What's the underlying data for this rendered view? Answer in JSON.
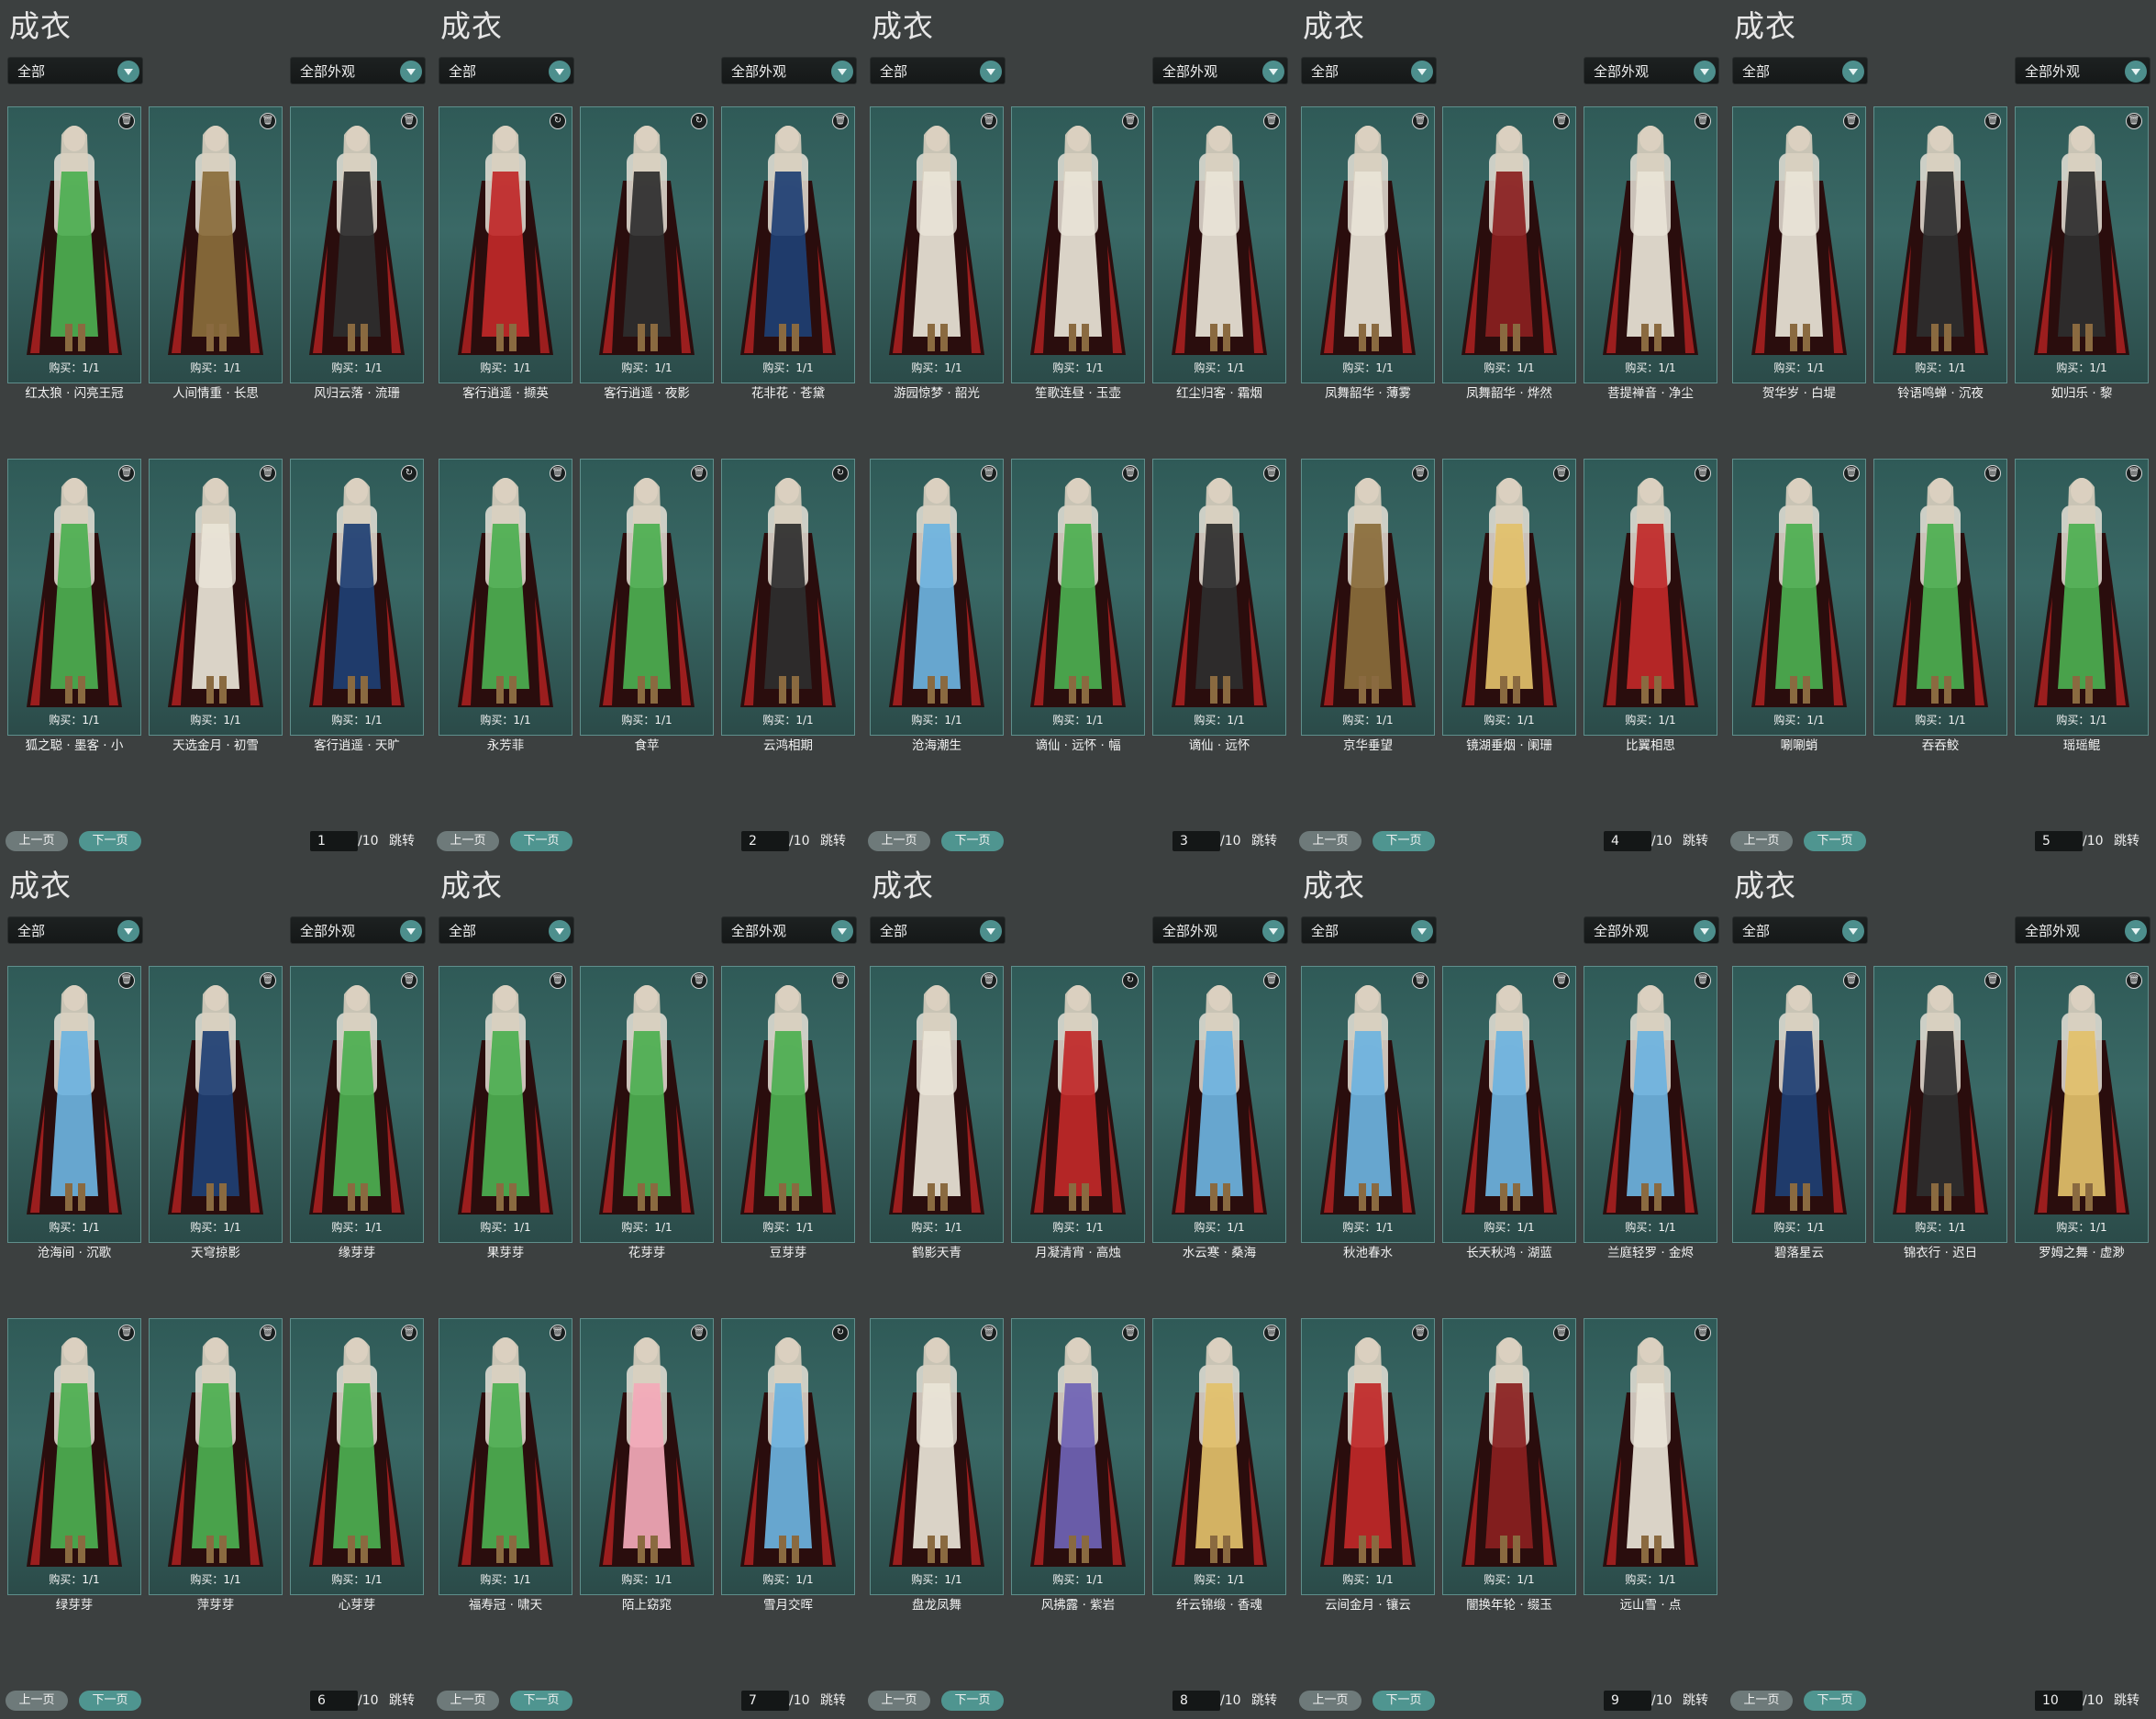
{
  "panel_title": "成衣",
  "filter_all": "全部",
  "filter_look": "全部外观",
  "buy_label": "购买：1/1",
  "prev_label": "上一页",
  "next_label": "下一页",
  "jump_label": "跳转",
  "total_label": "/10",
  "colors": {
    "card_bg": "#2f5a57",
    "accent": "#4f9590",
    "page_bg": "#3c4040",
    "dress_palette": [
      "#c02828",
      "#e9e4d7",
      "#2e2e2e",
      "#4caf50",
      "#6db3e0",
      "#1e3f73",
      "#8a6d3b",
      "#e2c06a",
      "#8a2020",
      "#f3a9b9",
      "#6f63b5"
    ]
  },
  "panels": [
    {
      "page": "1",
      "items": [
        {
          "name": "红太狼 · 闪亮王冠",
          "icon": "trash-icon"
        },
        {
          "name": "人间情重 · 长思",
          "icon": "trash-icon"
        },
        {
          "name": "风归云落 · 流珊",
          "icon": "trash-icon"
        },
        {
          "name": "狐之聪 · 墨客 · 小",
          "icon": "trash-icon"
        },
        {
          "name": "天选金月 · 初雪",
          "icon": "trash-icon"
        },
        {
          "name": "客行逍遥 · 天旷",
          "icon": "cycle-icon"
        }
      ]
    },
    {
      "page": "2",
      "items": [
        {
          "name": "客行逍遥 · 撷英",
          "icon": "cycle-icon"
        },
        {
          "name": "客行逍遥 · 夜影",
          "icon": "cycle-icon"
        },
        {
          "name": "花非花 · 苍黛",
          "icon": "trash-icon"
        },
        {
          "name": "永芳菲",
          "icon": "trash-icon"
        },
        {
          "name": "食苹",
          "icon": "trash-icon"
        },
        {
          "name": "云鸿相期",
          "icon": "cycle-icon"
        }
      ]
    },
    {
      "page": "3",
      "items": [
        {
          "name": "游园惊梦 · 韶光",
          "icon": "trash-icon"
        },
        {
          "name": "笙歌连昼 · 玉壶",
          "icon": "trash-icon"
        },
        {
          "name": "红尘归客 · 霜烟",
          "icon": "trash-icon"
        },
        {
          "name": "沧海潮生",
          "icon": "trash-icon"
        },
        {
          "name": "谪仙 · 远怀 · 幅",
          "icon": "trash-icon"
        },
        {
          "name": "谪仙 · 远怀",
          "icon": "trash-icon"
        }
      ]
    },
    {
      "page": "4",
      "items": [
        {
          "name": "凤舞韶华 · 薄雾",
          "icon": "trash-icon"
        },
        {
          "name": "凤舞韶华 · 烨然",
          "icon": "trash-icon"
        },
        {
          "name": "菩提禅音 · 净尘",
          "icon": "trash-icon"
        },
        {
          "name": "京华垂望",
          "icon": "trash-icon"
        },
        {
          "name": "镜湖垂烟 · 阑珊",
          "icon": "trash-icon"
        },
        {
          "name": "比翼相思",
          "icon": "trash-icon"
        }
      ]
    },
    {
      "page": "5",
      "items": [
        {
          "name": "贺华岁 · 白堤",
          "icon": "trash-icon"
        },
        {
          "name": "铃语鸣蝉 · 沉夜",
          "icon": "trash-icon"
        },
        {
          "name": "如归乐 · 黎",
          "icon": "trash-icon"
        },
        {
          "name": "唰唰蛸",
          "icon": "trash-icon"
        },
        {
          "name": "吞吞鲛",
          "icon": "trash-icon"
        },
        {
          "name": "瑶瑶鲲",
          "icon": "trash-icon"
        }
      ]
    },
    {
      "page": "6",
      "items": [
        {
          "name": "沧海间 · 沉歌",
          "icon": "trash-icon"
        },
        {
          "name": "天穹掠影",
          "icon": "trash-icon"
        },
        {
          "name": "缘芽芽",
          "icon": "trash-icon"
        },
        {
          "name": "绿芽芽",
          "icon": "trash-icon"
        },
        {
          "name": "萍芽芽",
          "icon": "trash-icon"
        },
        {
          "name": "心芽芽",
          "icon": "trash-icon"
        }
      ]
    },
    {
      "page": "7",
      "items": [
        {
          "name": "果芽芽",
          "icon": "trash-icon"
        },
        {
          "name": "花芽芽",
          "icon": "trash-icon"
        },
        {
          "name": "豆芽芽",
          "icon": "trash-icon"
        },
        {
          "name": "福寿冠 · 啸天",
          "icon": "trash-icon"
        },
        {
          "name": "陌上窈窕",
          "icon": "trash-icon"
        },
        {
          "name": "雪月交晖",
          "icon": "cycle-icon"
        }
      ]
    },
    {
      "page": "8",
      "items": [
        {
          "name": "鹤影天青",
          "icon": "trash-icon"
        },
        {
          "name": "月凝清宵 · 高烛",
          "icon": "cycle-icon"
        },
        {
          "name": "水云寒 · 桑海",
          "icon": "trash-icon"
        },
        {
          "name": "盘龙凤舞",
          "icon": "trash-icon"
        },
        {
          "name": "风拂露 · 紫岩",
          "icon": "trash-icon"
        },
        {
          "name": "纤云锦缎 · 香魂",
          "icon": "trash-icon"
        }
      ]
    },
    {
      "page": "9",
      "items": [
        {
          "name": "秋池春水",
          "icon": "trash-icon"
        },
        {
          "name": "长天秋鸿 · 湖蓝",
          "icon": "trash-icon"
        },
        {
          "name": "兰庭轻罗 · 金烬",
          "icon": "trash-icon"
        },
        {
          "name": "云间金月 · 镶云",
          "icon": "trash-icon"
        },
        {
          "name": "闇换年轮 · 缀玉",
          "icon": "trash-icon"
        },
        {
          "name": "远山雪 · 点",
          "icon": "trash-icon"
        }
      ]
    },
    {
      "page": "10",
      "items": [
        {
          "name": "碧落星云",
          "icon": "trash-icon"
        },
        {
          "name": "锦衣行 · 迟日",
          "icon": "trash-icon"
        },
        {
          "name": "罗姆之舞 · 虚渺",
          "icon": "trash-icon"
        }
      ]
    }
  ]
}
